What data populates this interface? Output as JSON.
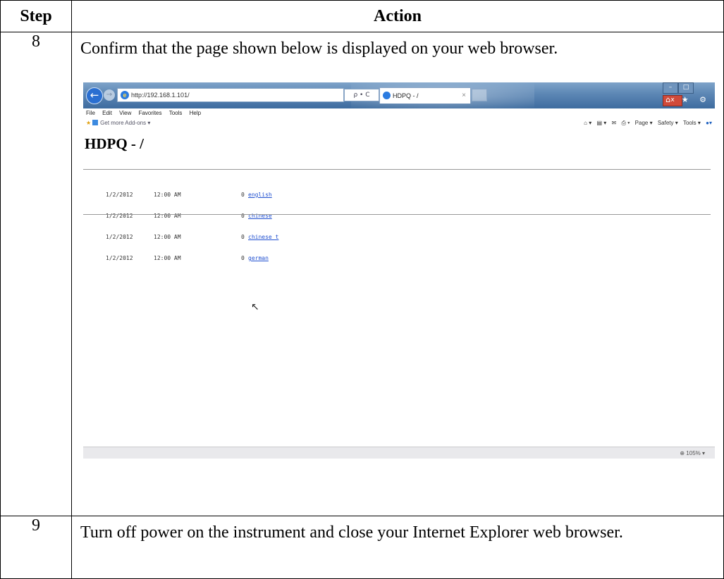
{
  "table": {
    "headers": {
      "step": "Step",
      "action": "Action"
    },
    "rows": [
      {
        "step": "8",
        "text": "Confirm that the page shown below is displayed on your web browser."
      },
      {
        "step": "9",
        "text": "Turn off power on the instrument and close your Internet Explorer web browser."
      }
    ]
  },
  "browser": {
    "address": "http://192.168.1.101/",
    "address_tools": "ρ • C",
    "tab_title": "HDPQ - /",
    "tab_close": "×",
    "window_buttons": {
      "minimize": "–",
      "maximize": "□",
      "close": "x"
    },
    "nav_icons": "⌂ ★ ⚙",
    "menu": [
      "File",
      "Edit",
      "View",
      "Favorites",
      "Tools",
      "Help"
    ],
    "favorites_label": "Get more Add-ons ▾",
    "command_bar": [
      "⌂ ▾",
      "▤ ▾",
      "✉",
      "⎙ ▾",
      "Page ▾",
      "Safety ▾",
      "Tools ▾",
      "●▾"
    ],
    "page_heading": "HDPQ - /",
    "listing": [
      {
        "date": "1/2/2012",
        "time": "12:00 AM",
        "size": "0",
        "name": "english"
      },
      {
        "date": "1/2/2012",
        "time": "12:00 AM",
        "size": "0",
        "name": "chinese"
      },
      {
        "date": "1/2/2012",
        "time": "12:00 AM",
        "size": "0",
        "name": "chinese t"
      },
      {
        "date": "1/2/2012",
        "time": "12:00 AM",
        "size": "0",
        "name": "german"
      }
    ],
    "zoom": "⊕ 105%  ▾"
  },
  "colors": {
    "titlebar": "#5c86b4",
    "link": "#1f4fd0"
  }
}
